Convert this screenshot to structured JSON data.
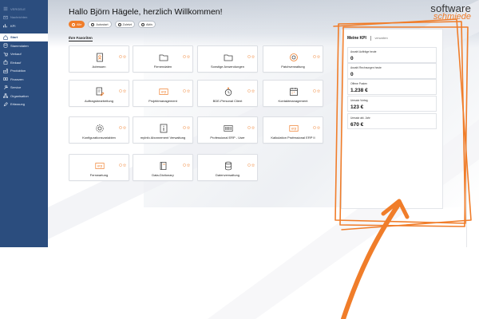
{
  "sidebar": {
    "top_items": [
      {
        "label": "VERGELE",
        "icon": "list-icon",
        "dim": true
      },
      {
        "label": "Nachrichten",
        "icon": "mail-icon",
        "dim": true
      },
      {
        "label": "KPI",
        "icon": "chart-icon",
        "dim": false
      }
    ],
    "items": [
      {
        "label": "Start",
        "icon": "home-icon",
        "active": true
      },
      {
        "label": "Stammdaten",
        "icon": "database-icon"
      },
      {
        "label": "Verkauf",
        "icon": "cart-icon"
      },
      {
        "label": "Einkauf",
        "icon": "bag-icon"
      },
      {
        "label": "Produktion",
        "icon": "factory-icon"
      },
      {
        "label": "Finanzen",
        "icon": "money-icon"
      },
      {
        "label": "Service",
        "icon": "wrench-icon"
      },
      {
        "label": "Organisation",
        "icon": "sitemap-icon"
      },
      {
        "label": "Erfassung",
        "icon": "edit-icon"
      }
    ]
  },
  "header": {
    "greeting": "Hallo Björn Hägele, herzlich Willkommen!"
  },
  "filters": [
    {
      "label": "Alle",
      "active": true
    },
    {
      "label": "Autostart",
      "active": false
    },
    {
      "label": "Zuletzt",
      "active": false
    },
    {
      "label": "Aktiv",
      "active": false
    }
  ],
  "favorites_title": "Ihre Favoriten",
  "tiles": [
    {
      "label": "Adressen",
      "icon": "address-book-icon"
    },
    {
      "label": "Firmendaten",
      "icon": "folder-icon"
    },
    {
      "label": "Sonstige Anwendungen",
      "icon": "folder-icon"
    },
    {
      "label": "Patchverwaltung",
      "icon": "target-icon"
    },
    {
      "label": "Auftragsbearbeitung",
      "icon": "document-edit-icon"
    },
    {
      "label": "Projektmanagement",
      "icon": "erp-icon"
    },
    {
      "label": "BDE-Personal Client",
      "icon": "clock-user-icon"
    },
    {
      "label": "Kontaktmanagement",
      "icon": "calendar-icon"
    },
    {
      "label": "Konfigurationsvariablen",
      "icon": "gear-icon"
    },
    {
      "label": "myInfo Abonnement Verwaltung",
      "icon": "info-icon"
    },
    {
      "label": "Professional ERP - User",
      "icon": "barcode-icon"
    },
    {
      "label": "Kalkulation Professional ERP II",
      "icon": "erp-icon"
    },
    {
      "label": "Fernwartung",
      "icon": "erp-icon"
    },
    {
      "label": "Data-Dictionary",
      "icon": "book-icon"
    },
    {
      "label": "Datenverwaltung",
      "icon": "database-icon"
    }
  ],
  "kpi": {
    "title": "Meine KPI",
    "edit_label": "verwalten",
    "items": [
      {
        "label": "Anzahl Aufträge heute",
        "value": "0"
      },
      {
        "label": "Anzahl Rechnungen heute",
        "value": "0"
      },
      {
        "label": "Offene Posten",
        "value": "1.238 €"
      },
      {
        "label": "Umsatz Vortag",
        "value": "123 €"
      },
      {
        "label": "Umsatz akt. Jahr",
        "value": "670 €"
      }
    ]
  },
  "logo": {
    "line1": "software",
    "line2": "schmiede"
  },
  "colors": {
    "accent": "#f07d2a",
    "sidebar": "#2b4d7e"
  }
}
